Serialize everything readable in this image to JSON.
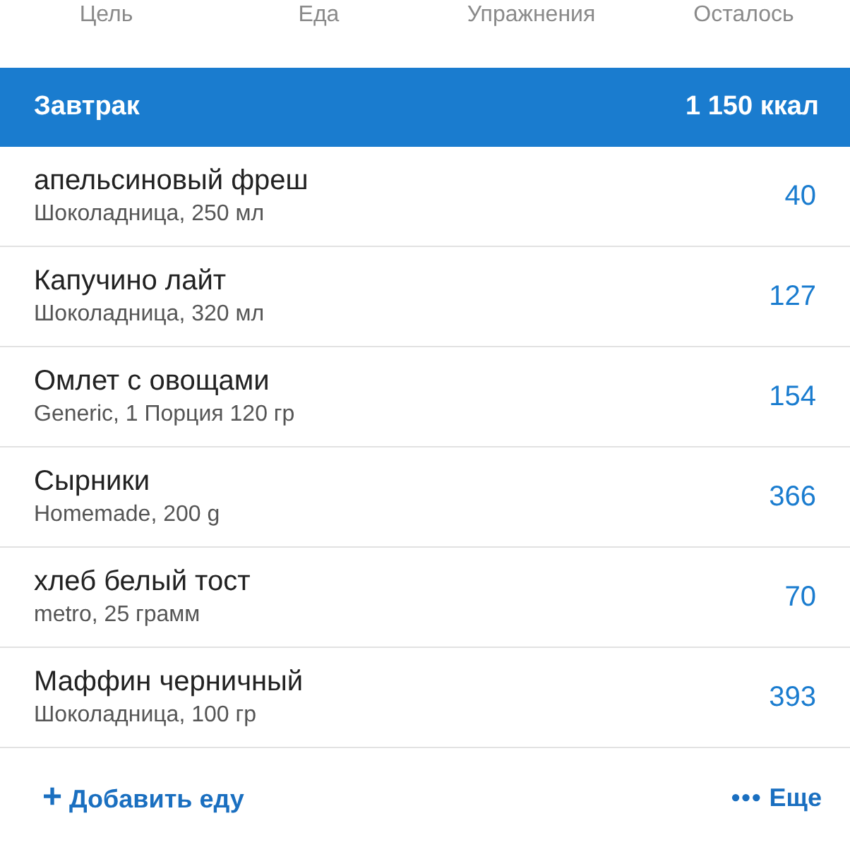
{
  "summary_columns": [
    "Цель",
    "Еда",
    "Упражнения",
    "Осталось"
  ],
  "meal": {
    "title": "Завтрак",
    "calories": "1 150 ккал"
  },
  "entries": [
    {
      "name": "апельсиновый фреш",
      "details": "Шоколадница, 250 мл",
      "calories": "40"
    },
    {
      "name": "Капучино лайт",
      "details": "Шоколадница, 320 мл",
      "calories": "127"
    },
    {
      "name": "Омлет с овощами",
      "details": "Generic, 1 Порция 120 гр",
      "calories": "154"
    },
    {
      "name": "Сырники",
      "details": "Homemade, 200 g",
      "calories": "366"
    },
    {
      "name": "хлеб белый тост",
      "details": "metro, 25 грамм",
      "calories": "70"
    },
    {
      "name": "Маффин черничный",
      "details": "Шоколадница, 100 гр",
      "calories": "393"
    }
  ],
  "actions": {
    "add_label": "Добавить еду",
    "add_icon": "+",
    "more_icon": "•••",
    "more_label": "Еще"
  }
}
